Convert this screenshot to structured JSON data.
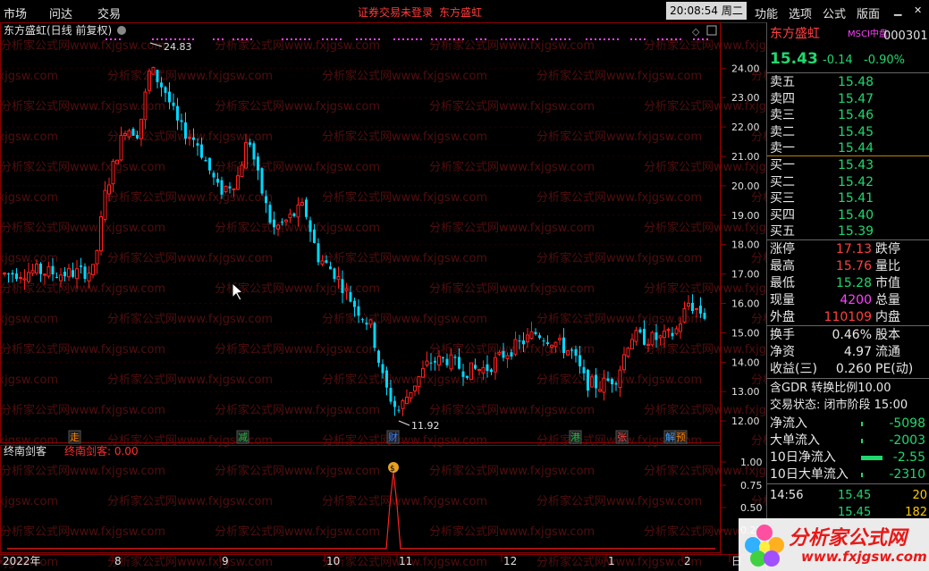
{
  "menubar": {
    "left": [
      "市场",
      "问达",
      "交易"
    ],
    "notice": "证券交易未登录",
    "stock": "东方盛虹",
    "clock": "20:08:54 周二",
    "right": [
      "功能",
      "选项",
      "公式",
      "版面"
    ]
  },
  "chart_header": {
    "title": "东方盛虹(日线 前复权)"
  },
  "indicator": {
    "name": "终南剑客",
    "value_label": "终南剑客: 0.00",
    "y_ticks": [
      "1.00",
      "0.75",
      "0.50",
      "0.25"
    ]
  },
  "price_axis": [
    "24.00",
    "23.00",
    "22.00",
    "21.00",
    "20.00",
    "19.00",
    "18.00",
    "17.00",
    "16.00",
    "15.00",
    "14.00",
    "13.00",
    "12.00"
  ],
  "date_axis": [
    "2022年",
    "8",
    "9",
    "10",
    "11",
    "12",
    "1",
    "2",
    "日"
  ],
  "annotations": {
    "high": "24.83",
    "low": "11.92"
  },
  "event_tags": [
    {
      "text": "走",
      "color": "#ff8000"
    },
    {
      "text": "减",
      "color": "#20c040"
    },
    {
      "text": "财",
      "color": "#4080ff"
    },
    {
      "text": "港",
      "color": "#20c040"
    },
    {
      "text": "张",
      "color": "#ff4040"
    },
    {
      "text": "解",
      "color": "#40a0ff"
    },
    {
      "text": "预",
      "color": "#ff8000"
    }
  ],
  "watermark": {
    "line1": "分析家公式网www.fxjgsw.com",
    "line2": "www.fxjgsw.com"
  },
  "quote": {
    "name": "东方盛虹",
    "tag": "MSCI中盘",
    "code": "000301",
    "price": "15.43",
    "change": "-0.14",
    "pct": "-0.90%",
    "asks": [
      {
        "label": "卖五",
        "price": "15.48"
      },
      {
        "label": "卖四",
        "price": "15.47"
      },
      {
        "label": "卖三",
        "price": "15.46"
      },
      {
        "label": "卖二",
        "price": "15.45"
      },
      {
        "label": "卖一",
        "price": "15.44"
      }
    ],
    "bids": [
      {
        "label": "买一",
        "price": "15.43"
      },
      {
        "label": "买二",
        "price": "15.42"
      },
      {
        "label": "买三",
        "price": "15.41"
      },
      {
        "label": "买四",
        "price": "15.40"
      },
      {
        "label": "买五",
        "price": "15.39"
      }
    ],
    "stats": [
      {
        "l": "涨停",
        "v": "17.13",
        "r": "跌停",
        "c": "red"
      },
      {
        "l": "最高",
        "v": "15.76",
        "r": "量比",
        "c": "red"
      },
      {
        "l": "最低",
        "v": "15.28",
        "r": "市值",
        "c": "green"
      },
      {
        "l": "现量",
        "v": "4200",
        "r": "总量",
        "c": "mag"
      },
      {
        "l": "外盘",
        "v": "110109",
        "r": "内盘",
        "c": "red"
      }
    ],
    "stats2": [
      {
        "l": "换手",
        "v": "0.46%",
        "r": "股本"
      },
      {
        "l": "净资",
        "v": "4.97",
        "r": "流通"
      },
      {
        "l": "收益(三)",
        "v": "0.260",
        "r": "PE(动)"
      }
    ],
    "gdr": "含GDR 转换比例10.00",
    "status": "交易状态: 闭市阶段 15:00",
    "flows": [
      {
        "l": "净流入",
        "v": "-5098"
      },
      {
        "l": "大单流入",
        "v": "-2003"
      },
      {
        "l": "10日净流入",
        "v": "-2.55"
      },
      {
        "l": "10日大单流入",
        "v": "-2310"
      }
    ],
    "ticks": [
      {
        "t": "14:56",
        "p": "15.45",
        "v": "20"
      },
      {
        "t": "",
        "p": "15.45",
        "v": "182"
      }
    ]
  },
  "logo": {
    "text": "分析家公式网",
    "url": "www.fxjgsw.com"
  },
  "colors": {
    "up": "#ff2020",
    "down": "#00d8ff",
    "bg": "#000000",
    "grid": "#8b0000"
  },
  "chart_data": {
    "type": "candlestick",
    "ylim": [
      11.6,
      24.9
    ],
    "high_label": 24.83,
    "low_label": 11.92
  }
}
